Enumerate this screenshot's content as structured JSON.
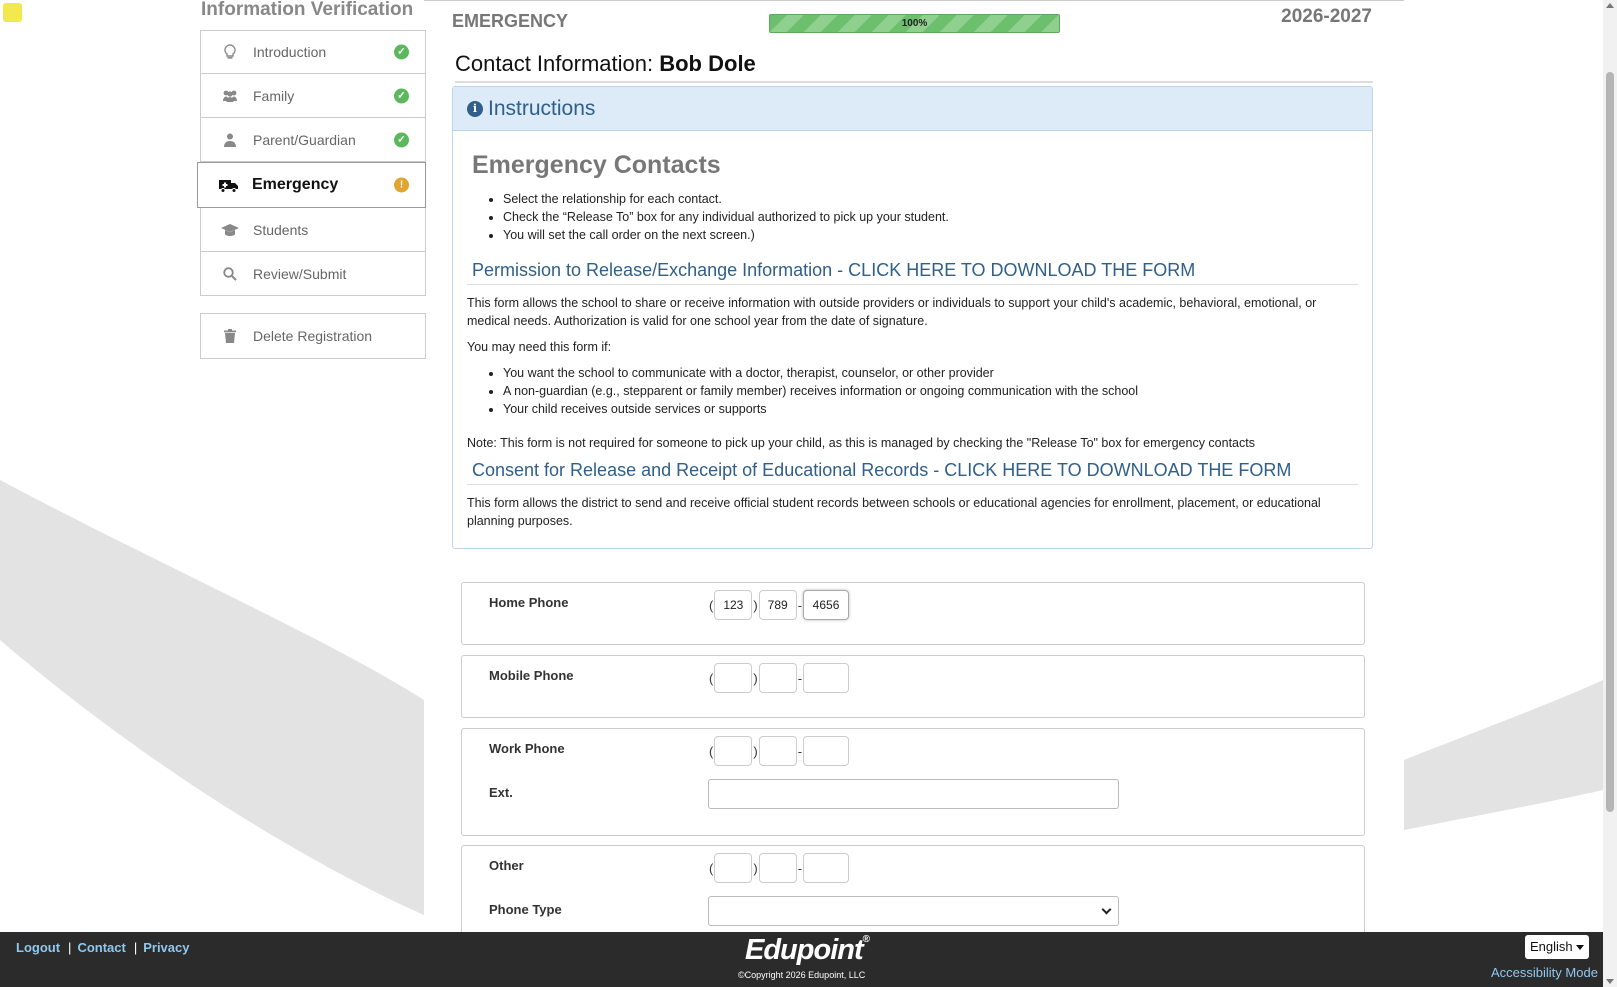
{
  "sidebar": {
    "title": "Information Verification",
    "items": [
      {
        "label": "Introduction",
        "icon": "lightbulb-icon",
        "status": "complete"
      },
      {
        "label": "Family",
        "icon": "users-icon",
        "status": "complete"
      },
      {
        "label": "Parent/Guardian",
        "icon": "user-icon",
        "status": "complete"
      },
      {
        "label": "Emergency",
        "icon": "ambulance-icon",
        "status": "warning",
        "active": true
      },
      {
        "label": "Students",
        "icon": "graduation-cap-icon"
      },
      {
        "label": "Review/Submit",
        "icon": "search-icon"
      }
    ],
    "delete_label": "Delete Registration"
  },
  "header": {
    "step_title": "EMERGENCY",
    "progress_label": "100%",
    "progress_value": 100,
    "school_year": "2026-2027"
  },
  "contact": {
    "label": "Contact Information:",
    "name": "Bob Dole"
  },
  "instructions": {
    "header": "Instructions",
    "title": "Emergency Contacts",
    "bullets": [
      "Select the relationship for each contact.",
      "Check the “Release To” box for any individual authorized to pick up your student.",
      "You will set the call order on the next screen.)"
    ],
    "permission": {
      "heading": "Permission to Release/Exchange Information - CLICK HERE TO DOWNLOAD THE FORM",
      "intro": "This form allows the school to share or receive information with outside providers or individuals to support your child's academic, behavioral, emotional, or medical needs. Authorization is valid for one school year from the date of signature.",
      "need_label": "You may need this form if:",
      "bullets": [
        "You want the school to communicate with a doctor, therapist, counselor, or other provider",
        "A non-guardian (e.g., stepparent or family member) receives information or ongoing communication with the school",
        "Your child receives outside services or supports"
      ],
      "note": "Note:  This form is not required for someone to pick up your child, as this is managed by checking the \"Release To\" box for emergency contacts"
    },
    "consent": {
      "heading": "Consent for Release and Receipt of Educational Records - CLICK HERE TO DOWNLOAD THE FORM",
      "text": "This form allows the district to send and receive official student records between schools or educational agencies for enrollment, placement, or educational planning purposes."
    }
  },
  "phones": {
    "home": {
      "label": "Home Phone",
      "area": "123",
      "prefix": "789",
      "line": "4656"
    },
    "mobile": {
      "label": "Mobile Phone",
      "area": "",
      "prefix": "",
      "line": ""
    },
    "work": {
      "label": "Work Phone",
      "area": "",
      "prefix": "",
      "line": "",
      "ext_label": "Ext.",
      "ext": ""
    },
    "other": {
      "label": "Other",
      "area": "",
      "prefix": "",
      "line": "",
      "type_label": "Phone Type",
      "type_value": ""
    }
  },
  "punct": {
    "open": "(",
    "close": ")",
    "dash": "-"
  },
  "footer": {
    "links": [
      "Logout",
      "Contact",
      "Privacy"
    ],
    "separator": "|",
    "logo": "Edupoint",
    "logo_mark": "®",
    "copyright": "©Copyright 2026 Edupoint, LLC",
    "language": "English",
    "accessibility": "Accessibility Mode"
  },
  "colors": {
    "accent": "#2f5f8a",
    "complete": "#5cb85c",
    "warning": "#e0a630",
    "footer_bg": "#2b2b2b",
    "link": "#8ec8f0"
  }
}
